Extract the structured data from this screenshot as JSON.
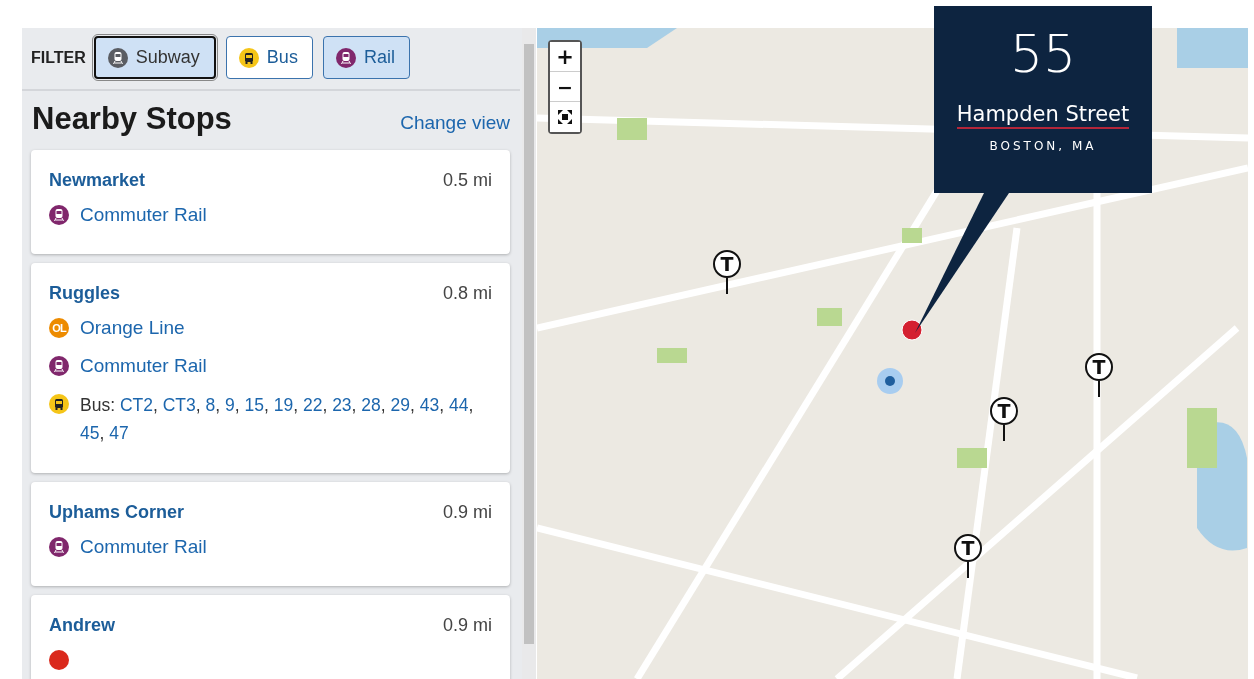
{
  "filter": {
    "label": "FILTER",
    "options": [
      {
        "kind": "subway",
        "label": "Subway",
        "selected": true,
        "focused": true
      },
      {
        "kind": "bus",
        "label": "Bus",
        "selected": false,
        "focused": false
      },
      {
        "kind": "rail",
        "label": "Rail",
        "selected": true,
        "focused": false
      }
    ]
  },
  "heading": "Nearby Stops",
  "change_view": "Change view",
  "stops": [
    {
      "name": "Newmarket",
      "distance": "0.5 mi",
      "routes": [
        {
          "kind": "rail",
          "label": "Commuter Rail"
        }
      ]
    },
    {
      "name": "Ruggles",
      "distance": "0.8 mi",
      "routes": [
        {
          "kind": "orange",
          "badge": "OL",
          "label": "Orange Line"
        },
        {
          "kind": "rail",
          "label": "Commuter Rail"
        },
        {
          "kind": "bus",
          "prefix": "Bus:",
          "separator": ",",
          "lines": [
            "CT2",
            "CT3",
            "8",
            "9",
            "15",
            "19",
            "22",
            "23",
            "28",
            "29",
            "43",
            "44",
            "45",
            "47"
          ]
        }
      ]
    },
    {
      "name": "Uphams Corner",
      "distance": "0.9 mi",
      "routes": [
        {
          "kind": "rail",
          "label": "Commuter Rail"
        }
      ]
    },
    {
      "name": "Andrew",
      "distance": "0.9 mi",
      "routes": [
        {
          "kind": "red"
        }
      ]
    }
  ],
  "map": {
    "zoom_controls": [
      {
        "kind": "zoom-in",
        "label": "+"
      },
      {
        "kind": "zoom-out",
        "label": "−"
      },
      {
        "kind": "fit"
      }
    ],
    "markers": [
      {
        "kind": "station",
        "label": "T"
      },
      {
        "kind": "station",
        "label": "T"
      },
      {
        "kind": "station",
        "label": "T"
      },
      {
        "kind": "station",
        "label": "T"
      },
      {
        "kind": "selected"
      },
      {
        "kind": "current-location"
      }
    ]
  },
  "callout": {
    "number": "55",
    "street": "Hampden Street",
    "city": "BOSTON, MA"
  }
}
